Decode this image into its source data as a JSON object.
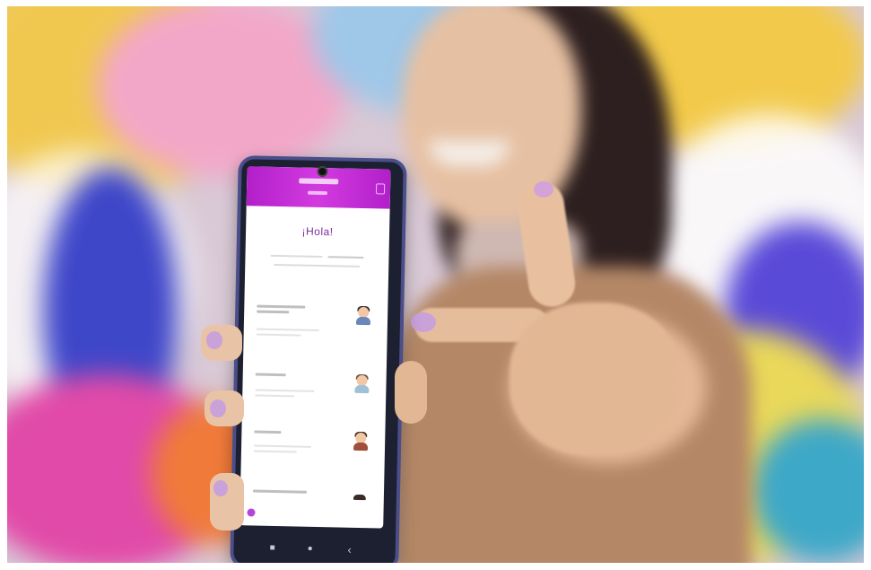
{
  "photo": {
    "subject": "",
    "phone_screen": {
      "greeting": "¡Hola!",
      "header_color": "#c12dd6",
      "accent_color": "#7d2b9e",
      "nav_buttons": [
        "■",
        "●",
        "‹"
      ]
    },
    "colors": {
      "jacket": "#b48766",
      "skin": "#e9c3a6",
      "nail_polish": "#c8a2d9",
      "background_purple": "#6d5ad6",
      "background_pink": "#e04ca8",
      "background_yellow": "#f2c94a"
    }
  }
}
